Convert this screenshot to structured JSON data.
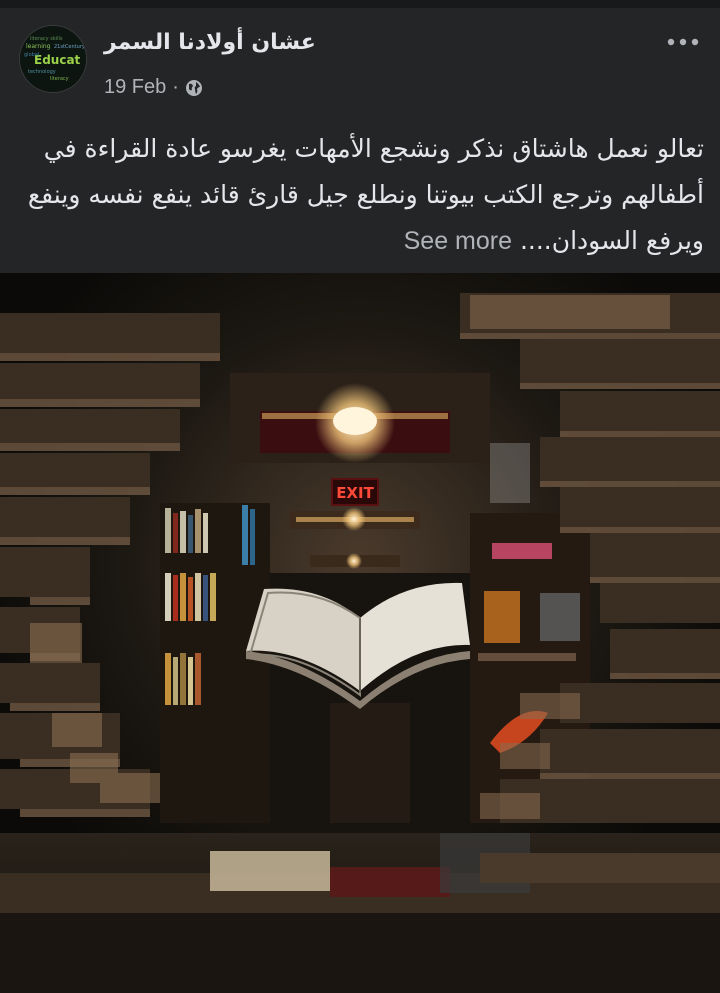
{
  "post": {
    "author": "عشان أولادنا السمر",
    "date": "19 Feb",
    "separator": "·",
    "privacy_icon": "globe-icon",
    "more_icon": "more-options-icon",
    "text": "تعالو نعمل هاشتاق نذكر ونشجع الأمهات يغرسو عادة القراءة في أطفالهم وترجع الكتب بيوتنا ونطلع جيل قارئ قائد ينفع نفسه وينفع ويرفع السودان....",
    "see_more": "See more",
    "avatar_text": "21stCentury Educat",
    "photo": {
      "exit_sign": "EXIT"
    }
  },
  "colors": {
    "card_bg": "#242526",
    "page_bg": "#18191a",
    "primary_text": "#e4e6eb",
    "secondary_text": "#b0b3b8"
  }
}
